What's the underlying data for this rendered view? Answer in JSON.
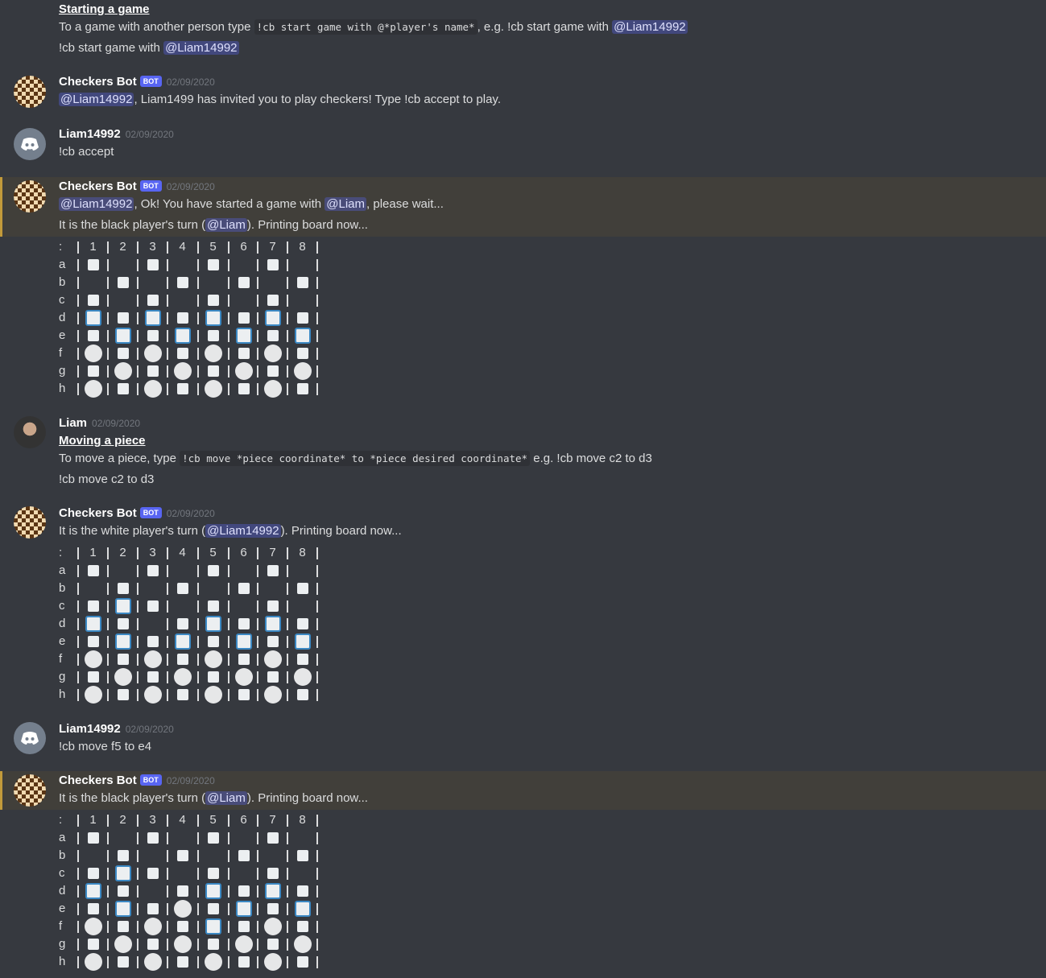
{
  "intro": {
    "heading": "Starting a game",
    "text1": "To a game with another person type ",
    "code": "!cb start game with @*player's name*",
    "text2": ", e.g. !cb start game with ",
    "mention": "@Liam14992",
    "example_prefix": "!cb start game with ",
    "example_mention": "@Liam14992"
  },
  "msg_invite": {
    "author": "Checkers Bot",
    "badge": "BOT",
    "timestamp": "02/09/2020",
    "mention": "@Liam14992",
    "text": ", Liam1499 has invited you to play checkers! Type !cb accept to play."
  },
  "msg_accept": {
    "author": "Liam14992",
    "timestamp": "02/09/2020",
    "text": "!cb accept"
  },
  "msg_started": {
    "author": "Checkers Bot",
    "badge": "BOT",
    "timestamp": "02/09/2020",
    "mention1": "@Liam14992",
    "text1": ", Ok! You have started a game with ",
    "mention2": "@Liam",
    "text2": ", please wait...",
    "turn_prefix": "It is the black player's turn (",
    "turn_mention": "@Liam",
    "turn_suffix": "). Printing board now..."
  },
  "msg_howto": {
    "author": "Liam",
    "timestamp": "02/09/2020",
    "heading": "Moving a piece",
    "text1": "To move a piece, type ",
    "code": "!cb move *piece coordinate* to *piece desired coordinate*",
    "text2": " e.g. !cb move c2 to d3",
    "example": "!cb move c2 to d3"
  },
  "msg_white": {
    "author": "Checkers Bot",
    "badge": "BOT",
    "timestamp": "02/09/2020",
    "turn_prefix": "It is the white player's turn (",
    "turn_mention": "@Liam14992",
    "turn_suffix": "). Printing board now..."
  },
  "msg_move": {
    "author": "Liam14992",
    "timestamp": "02/09/2020",
    "text": "!cb move f5 to e4"
  },
  "msg_black": {
    "author": "Checkers Bot",
    "badge": "BOT",
    "timestamp": "02/09/2020",
    "turn_prefix": "It is the black player's turn (",
    "turn_mention": "@Liam",
    "turn_suffix": "). Printing board now..."
  },
  "board_header": [
    ":",
    "1",
    "2",
    "3",
    "4",
    "5",
    "6",
    "7",
    "8"
  ],
  "board_rows": [
    "a",
    "b",
    "c",
    "d",
    "e",
    "f",
    "g",
    "h"
  ],
  "boards": [
    {
      "name": "board-1",
      "cells": [
        "W.W.W.W.",
        ".W.W.W.W",
        "W.W.W.W.",
        "BWBWBWBW",
        "WBWBWBWB",
        "OWOWOWOW",
        "WOWOWOWO",
        "OWOWOWOW"
      ]
    },
    {
      "name": "board-2",
      "cells": [
        "W.W.W.W.",
        ".W.W.W.W",
        "WBW.W.W.",
        "BW.WBWBW",
        "WBWBWBWB",
        "OWOWOWOW",
        "WOWOWOWO",
        "OWOWOWOW"
      ]
    },
    {
      "name": "board-3",
      "cells": [
        "W.W.W.W.",
        ".W.W.W.W",
        "WBW.W.W.",
        "BW.WBWBW",
        "WBWOWBWB",
        "OWOWBWOW",
        "WOWOWOWO",
        "OWOWOWOW"
      ]
    }
  ],
  "cell_legend": {
    "W": "white square",
    ".": "empty dark square",
    "B": "blue square piece",
    "O": "white circle piece"
  }
}
